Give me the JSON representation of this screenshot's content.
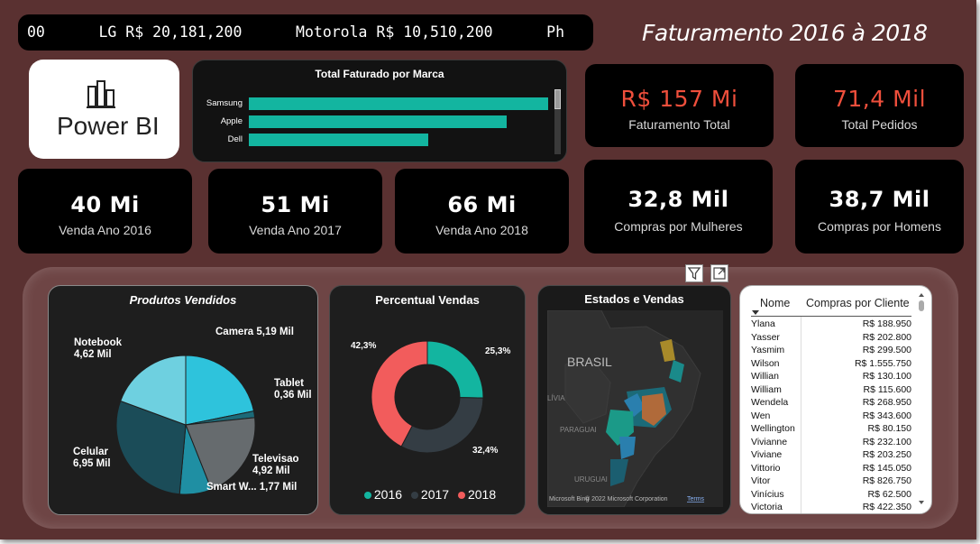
{
  "ticker": {
    "text": "00      LG R$ 20,181,200      Motorola R$ 10,510,200      Ph"
  },
  "header": {
    "title": "Faturamento  2016 à 2018"
  },
  "logo": {
    "text": "Power BI"
  },
  "bar_chart": {
    "title": "Total Faturado por Marca",
    "chart_data": {
      "type": "bar",
      "orientation": "horizontal",
      "categories": [
        "Samsung",
        "Apple",
        "Dell"
      ],
      "values": [
        100,
        86,
        60
      ],
      "title": "Total Faturado por Marca",
      "color": "#13b5a0"
    }
  },
  "kpis": {
    "faturamento_total": {
      "value": "R$ 157 Mi",
      "label": "Faturamento Total"
    },
    "total_pedidos": {
      "value": "71,4 Mil",
      "label": "Total Pedidos"
    },
    "venda_2016": {
      "value": "40 Mi",
      "label": "Venda Ano 2016"
    },
    "venda_2017": {
      "value": "51 Mi",
      "label": "Venda Ano 2017"
    },
    "venda_2018": {
      "value": "66 Mi",
      "label": "Venda Ano 2018"
    },
    "compras_mulheres": {
      "value": "32,8 Mil",
      "label": "Compras por Mulheres"
    },
    "compras_homens": {
      "value": "38,7 Mil",
      "label": "Compras por Homens"
    }
  },
  "pie": {
    "title": "Produtos Vendidos",
    "chart_data": {
      "type": "pie",
      "title": "Produtos Vendidos",
      "slices": [
        {
          "name": "Camera",
          "value": 5.19,
          "label": "Camera 5,19 Mil",
          "color": "#2ec3dc"
        },
        {
          "name": "Tablet",
          "value": 0.36,
          "label_name": "Tablet",
          "label_value": "0,36 Mil",
          "color": "#1c6a78"
        },
        {
          "name": "Televisao",
          "value": 4.92,
          "label_name": "Televisao",
          "label_value": "4,92 Mil",
          "color": "#666b6e"
        },
        {
          "name": "Smart W...",
          "value": 1.77,
          "label": "Smart W... 1,77 Mil",
          "color": "#1f8fa3"
        },
        {
          "name": "Celular",
          "value": 6.95,
          "label_name": "Celular",
          "label_value": "6,95 Mil",
          "color": "#1b4c58"
        },
        {
          "name": "Notebook",
          "value": 4.62,
          "label_name": "Notebook",
          "label_value": "4,62 Mil",
          "color": "#6ed0e0"
        }
      ]
    }
  },
  "donut": {
    "title": "Percentual Vendas",
    "chart_data": {
      "type": "pie",
      "variant": "donut",
      "title": "Percentual Vendas",
      "slices": [
        {
          "name": "2016",
          "value": 25.3,
          "label": "25,3%",
          "color": "#13b5a0"
        },
        {
          "name": "2017",
          "value": 32.4,
          "label": "32,4%",
          "color": "#343d44"
        },
        {
          "name": "2018",
          "value": 42.3,
          "label": "42,3%",
          "color": "#f25c5c"
        }
      ]
    },
    "legend": [
      "2016",
      "2017",
      "2018"
    ]
  },
  "map": {
    "title": "Estados e Vendas",
    "country_label": "BRASIL",
    "labels": [
      "LÍVIA",
      "PARAGUAI",
      "URUGUAI"
    ],
    "attribution": "© 2022 Microsoft Corporation",
    "brand": "Microsoft Bing",
    "terms": "Terms"
  },
  "toolbar": {
    "filter_icon": "filter-icon",
    "focus_icon": "focus-mode-icon"
  },
  "table": {
    "headers": [
      "Nome",
      "Compras por Cliente"
    ],
    "rows": [
      [
        "Ylana",
        "R$ 188.950"
      ],
      [
        "Yasser",
        "R$ 202.800"
      ],
      [
        "Yasmim",
        "R$ 299.500"
      ],
      [
        "Wilson",
        "R$ 1.555.750"
      ],
      [
        "Willian",
        "R$ 130.100"
      ],
      [
        "William",
        "R$ 115.600"
      ],
      [
        "Wendela",
        "R$ 268.950"
      ],
      [
        "Wen",
        "R$ 343.600"
      ],
      [
        "Wellington",
        "R$ 80.150"
      ],
      [
        "Vivianne",
        "R$ 232.100"
      ],
      [
        "Viviane",
        "R$ 203.250"
      ],
      [
        "Vittorio",
        "R$ 145.050"
      ],
      [
        "Vitor",
        "R$ 826.750"
      ],
      [
        "Vinícius",
        "R$ 62.500"
      ],
      [
        "Victoria",
        "R$ 422.350"
      ]
    ]
  }
}
